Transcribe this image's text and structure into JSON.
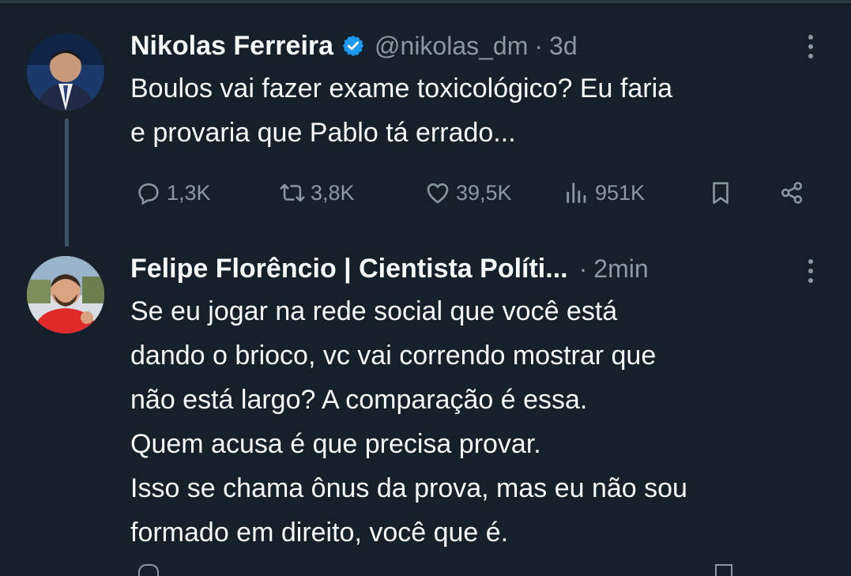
{
  "tweet": {
    "author_name": "Nikolas Ferreira",
    "handle": "@nikolas_dm",
    "separator": "·",
    "time": "3d",
    "text_lines": [
      "Boulos vai fazer exame toxicológico? Eu faria",
      "e provaria que Pablo tá errado..."
    ],
    "stats": {
      "replies": "1,3K",
      "retweets": "3,8K",
      "likes": "39,5K",
      "views": "951K"
    }
  },
  "reply": {
    "author_name": "Felipe Florêncio | Cientista Políti...",
    "separator": "·",
    "time": "2min",
    "text_lines": [
      "Se eu jogar na rede social que você está",
      "dando o brioco, vc vai correndo mostrar que",
      "não está largo? A comparação é essa.",
      "Quem acusa é que precisa provar.",
      "Isso se chama ônus da prova, mas eu não sou",
      "formado em direito, você que é."
    ]
  },
  "colors": {
    "background": "#15202b",
    "text": "#f7f9f9",
    "secondary": "#8b98a5",
    "verified": "#1d9bf0"
  },
  "icons": {
    "reply": "reply-icon",
    "retweet": "retweet-icon",
    "like": "heart-icon",
    "views": "views-icon",
    "bookmark": "bookmark-icon",
    "share": "share-icon",
    "more": "more-icon"
  }
}
